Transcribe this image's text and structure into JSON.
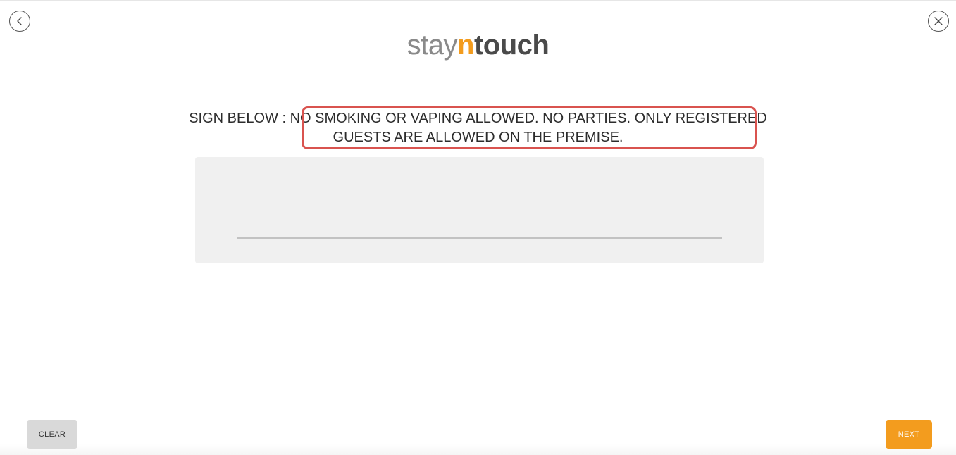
{
  "nav": {
    "back_icon": "chevron-left-icon",
    "close_icon": "close-icon"
  },
  "logo": {
    "part1": "stay",
    "part2": "n",
    "part3": "touch"
  },
  "instruction": {
    "prefix": "SIGN BELOW : ",
    "message": "NO SMOKING OR VAPING ALLOWED. NO PARTIES. ONLY REGISTERED GUESTS ARE ALLOWED ON THE PREMISE."
  },
  "buttons": {
    "clear_label": "CLEAR",
    "next_label": "NEXT"
  },
  "colors": {
    "accent": "#f39c1e",
    "highlight": "#d9534f",
    "pad_background": "#f0f0f0"
  }
}
